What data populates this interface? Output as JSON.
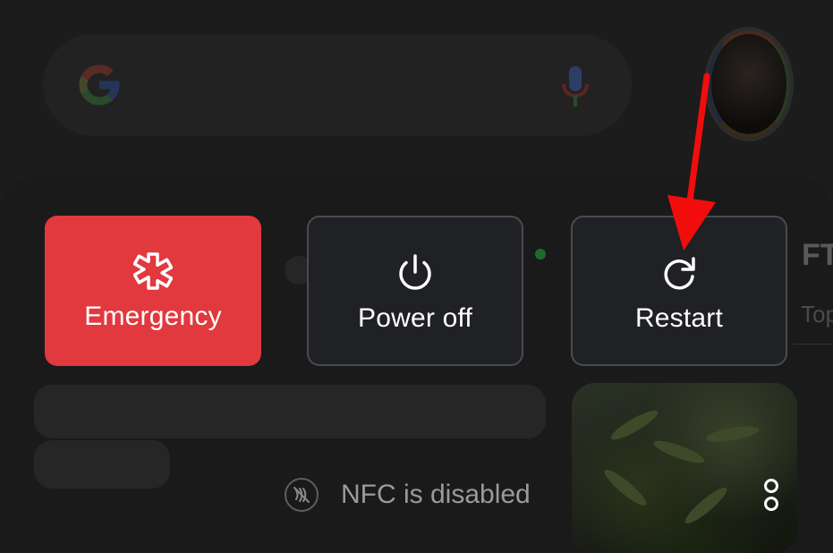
{
  "power_menu": {
    "emergency": {
      "label": "Emergency",
      "icon": "medical-asterisk-icon"
    },
    "power_off": {
      "label": "Power off",
      "icon": "power-icon"
    },
    "restart": {
      "label": "Restart",
      "icon": "restart-icon"
    }
  },
  "status": {
    "nfc_text": "NFC is disabled",
    "nfc_icon": "nfc-disabled-icon"
  },
  "background": {
    "search_logo_icon": "google-g-icon",
    "voice_icon": "microphone-icon",
    "feed_partial_title": "FT",
    "feed_partial_subtitle": "Top"
  },
  "annotation": {
    "arrow_color": "#f20d0d"
  },
  "colors": {
    "emergency_red": "#e1393e",
    "button_dark": "#202124",
    "button_border": "#4a4b4e"
  }
}
